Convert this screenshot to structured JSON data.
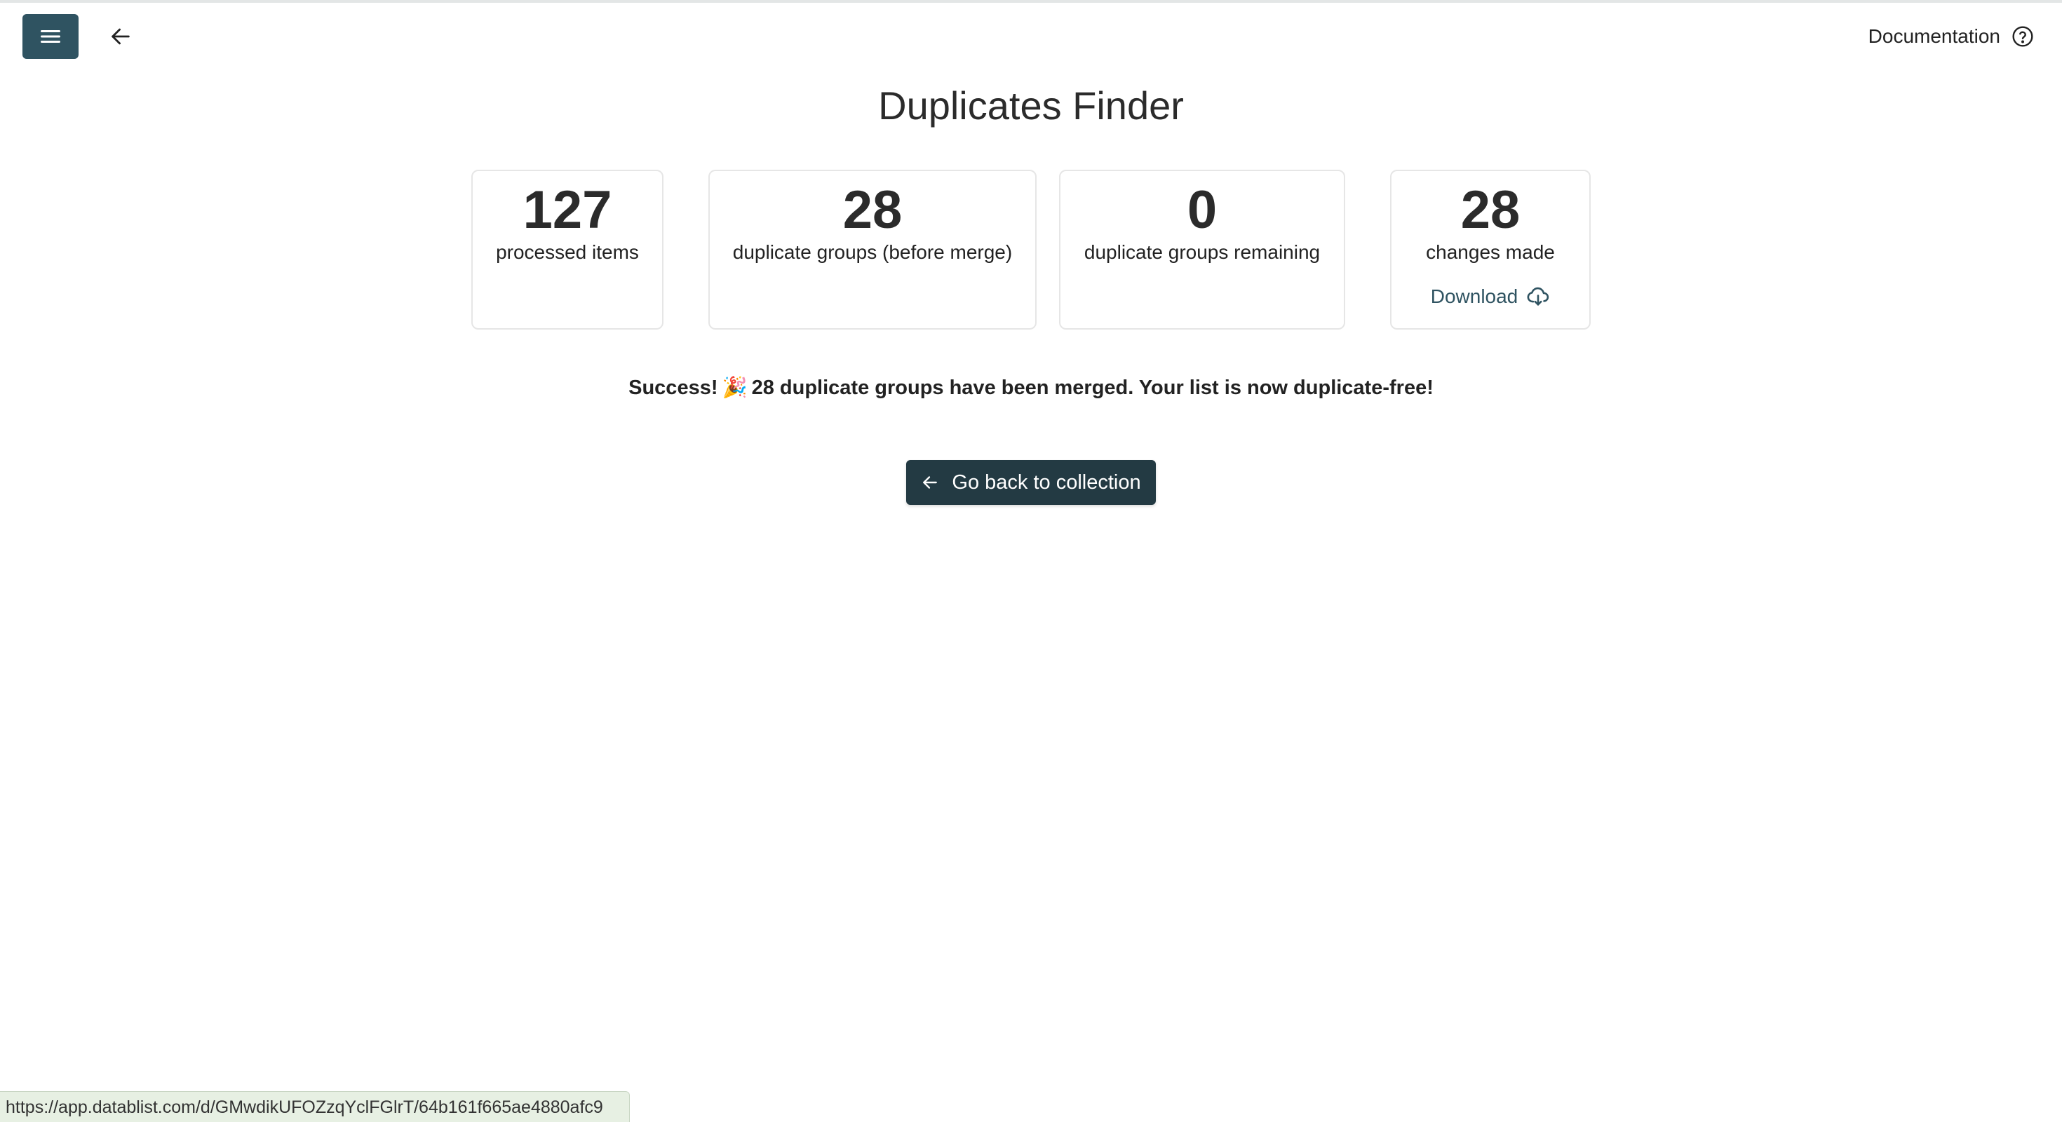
{
  "header": {
    "documentation_label": "Documentation"
  },
  "page": {
    "title": "Duplicates Finder"
  },
  "stats": [
    {
      "value": "127",
      "label": "processed items"
    },
    {
      "value": "28",
      "label": "duplicate groups (before merge)"
    },
    {
      "value": "0",
      "label": "duplicate groups remaining"
    },
    {
      "value": "28",
      "label": "changes made",
      "action_label": "Download"
    }
  ],
  "success": {
    "prefix": "Success!",
    "emoji": "🎉",
    "message": "28 duplicate groups have been merged. Your list is now duplicate-free!"
  },
  "actions": {
    "go_back_label": "Go back to collection"
  },
  "status_bar": {
    "url": "https://app.datablist.com/d/GMwdikUFOZzqYclFGlrT/64b161f665ae4880afc9"
  },
  "colors": {
    "primary": "#2f5361",
    "button_dark": "#233a43"
  },
  "icons": {
    "menu": "hamburger-menu-icon",
    "back": "arrow-left-icon",
    "help": "question-circle-icon",
    "download": "cloud-download-icon"
  }
}
